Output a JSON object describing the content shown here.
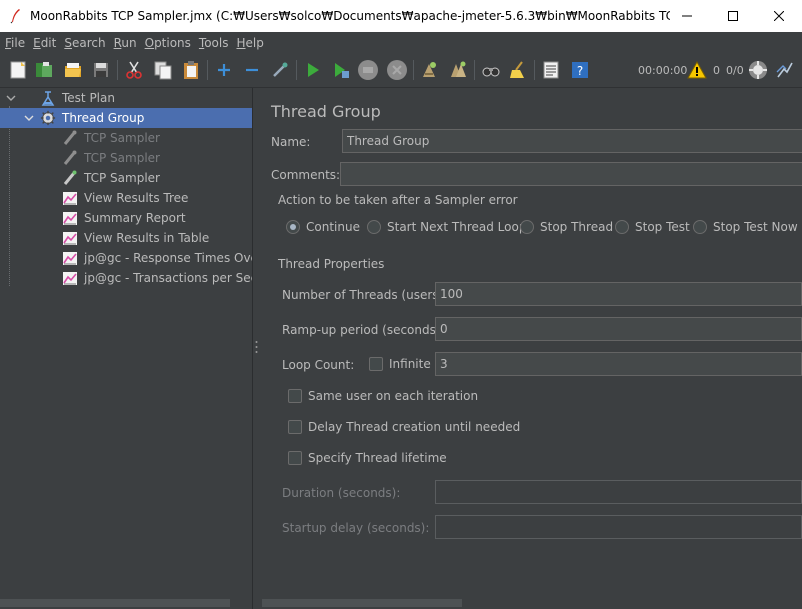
{
  "window": {
    "title": "MoonRabbits TCP Sampler.jmx (C:₩Users₩solco₩Documents₩apache-jmeter-5.6.3₩bin₩MoonRabbits TCP Sampl..."
  },
  "menu": {
    "items": [
      {
        "first": "F",
        "rest": "ile"
      },
      {
        "first": "E",
        "rest": "dit"
      },
      {
        "first": "S",
        "rest": "earch"
      },
      {
        "first": "R",
        "rest": "un"
      },
      {
        "first": "O",
        "rest": "ptions"
      },
      {
        "first": "T",
        "rest": "ools"
      },
      {
        "first": "H",
        "rest": "elp"
      }
    ]
  },
  "toolbar": {
    "timer": "00:00:00",
    "warning_count": "0",
    "thread_ratio": "0/0"
  },
  "tree": {
    "items": [
      {
        "label": "Test Plan",
        "icon": "test-plan-icon"
      },
      {
        "label": "Thread Group",
        "icon": "gear-icon"
      },
      {
        "label": "TCP Sampler",
        "icon": "sampler-icon"
      },
      {
        "label": "TCP Sampler",
        "icon": "sampler-icon"
      },
      {
        "label": "TCP Sampler",
        "icon": "sampler-icon"
      },
      {
        "label": "View Results Tree",
        "icon": "listener-icon"
      },
      {
        "label": "Summary Report",
        "icon": "listener-icon"
      },
      {
        "label": "View Results in Table",
        "icon": "listener-icon"
      },
      {
        "label": "jp@gc - Response Times Over Time",
        "icon": "listener-icon"
      },
      {
        "label": "jp@gc - Transactions per Second",
        "icon": "listener-icon"
      }
    ]
  },
  "panel": {
    "title": "Thread Group",
    "name_label": "Name:",
    "name_value": "Thread Group",
    "comments_label": "Comments:",
    "comments_value": "",
    "error_group_title": "Action to be taken after a Sampler error",
    "error_options": [
      {
        "label": "Continue",
        "selected": true
      },
      {
        "label": "Start Next Thread Loop",
        "selected": false
      },
      {
        "label": "Stop Thread",
        "selected": false
      },
      {
        "label": "Stop Test",
        "selected": false
      },
      {
        "label": "Stop Test Now",
        "selected": false
      }
    ],
    "props_group_title": "Thread Properties",
    "threads_label": "Number of Threads (users):",
    "threads_value": "100",
    "rampup_label": "Ramp-up period (seconds):",
    "rampup_value": "0",
    "loop_label": "Loop Count:",
    "infinite_label": "Infinite",
    "loop_value": "3",
    "same_user_label": "Same user on each iteration",
    "delay_creation_label": "Delay Thread creation until needed",
    "specify_lifetime_label": "Specify Thread lifetime",
    "duration_label": "Duration (seconds):",
    "duration_value": "",
    "startup_delay_label": "Startup delay (seconds):",
    "startup_delay_value": ""
  }
}
